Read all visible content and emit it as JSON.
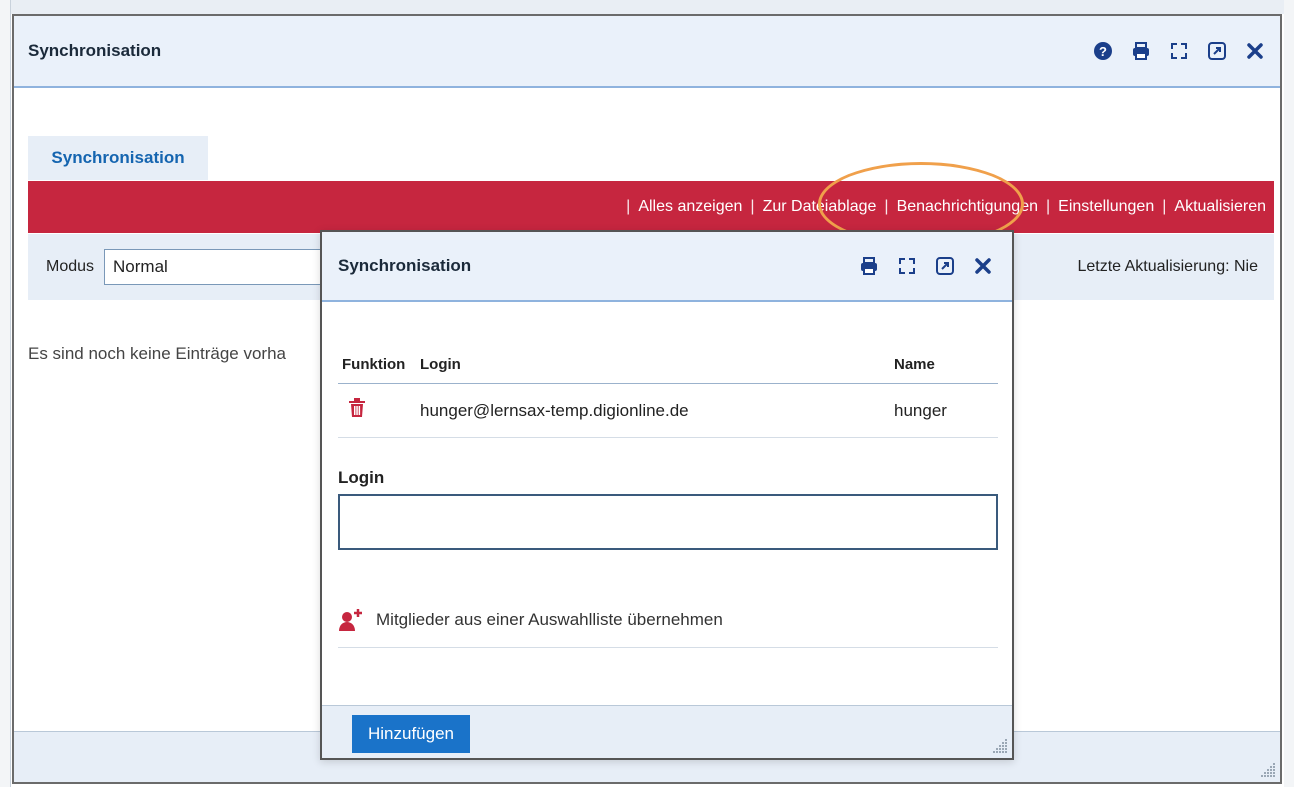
{
  "outer": {
    "title": "Synchronisation",
    "header_icons": [
      "help-icon",
      "print-icon",
      "fullscreen-icon",
      "popout-icon",
      "close-icon"
    ],
    "tab_label": "Synchronisation",
    "nav_links": [
      "Alles anzeigen",
      "Zur Dateiablage",
      "Benachrichtigungen",
      "Einstellungen",
      "Aktualisieren"
    ],
    "nav_separator": "|",
    "modus_label": "Modus",
    "modus_value": "Normal",
    "last_update": "Letzte Aktualisierung: Nie",
    "empty_message": "Es sind noch keine Einträge vorha"
  },
  "inner": {
    "title": "Synchronisation",
    "header_icons": [
      "print-icon",
      "fullscreen-icon",
      "popout-icon",
      "close-icon"
    ],
    "table": {
      "headers": [
        "Funktion",
        "Login",
        "Name"
      ],
      "rows": [
        {
          "function_icon": "trash-icon",
          "login": "hunger@lernsax-temp.digionline.de",
          "name": "hunger"
        }
      ]
    },
    "login_label": "Login",
    "login_value": "",
    "add_members_label": "Mitglieder aus einer Auswahlliste übernehmen",
    "add_button": "Hinzufügen"
  },
  "colors": {
    "accent_red": "#c6263f",
    "primary_blue": "#1a73c9",
    "header_bg": "#eaf1fa",
    "highlight": "#f0a04b"
  }
}
